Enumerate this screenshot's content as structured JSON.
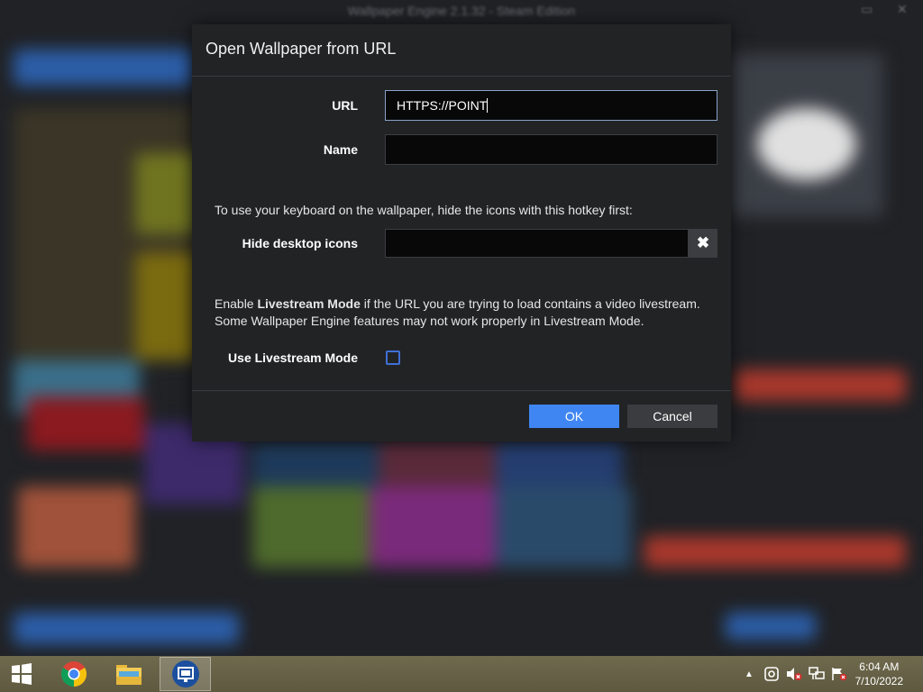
{
  "background_app": {
    "title": "Wallpaper Engine 2.1.32 - Steam Edition"
  },
  "dialog": {
    "title": "Open Wallpaper from URL",
    "url_label": "URL",
    "url_value": "HTTPS://POINT",
    "name_label": "Name",
    "name_value": "",
    "hotkey_intro": "To use your keyboard on the wallpaper, hide the icons with this hotkey first:",
    "hotkey_label": "Hide desktop icons",
    "hotkey_value": "",
    "livestream_text_prefix": "Enable ",
    "livestream_text_bold": "Livestream Mode",
    "livestream_text_suffix": " if the URL you are trying to load contains a video livestream.",
    "livestream_text_line2": "Some Wallpaper Engine features may not work properly in Livestream Mode.",
    "livestream_label": "Use Livestream Mode",
    "livestream_checked": false,
    "ok_label": "OK",
    "cancel_label": "Cancel",
    "clear_icon": "close-x-icon"
  },
  "taskbar": {
    "start_icon": "windows-logo-icon",
    "pinned": [
      {
        "name": "chrome",
        "icon": "chrome-icon"
      },
      {
        "name": "file-explorer",
        "icon": "folder-icon"
      },
      {
        "name": "wallpaper-engine",
        "icon": "wallpaper-engine-icon",
        "active": true
      }
    ],
    "tray": {
      "icons": [
        "show-hidden-icons-chevron-icon",
        "webcam-icon",
        "speaker-muted-icon",
        "network-icon",
        "action-center-flag-icon"
      ]
    },
    "clock": {
      "time": "6:04 AM",
      "date": "7/10/2022"
    }
  },
  "colors": {
    "accent": "#3f86f2",
    "dialog_bg": "#222325",
    "input_bg": "#080808",
    "checkbox_border": "#3f6fd6",
    "taskbar": "#6a654a"
  }
}
